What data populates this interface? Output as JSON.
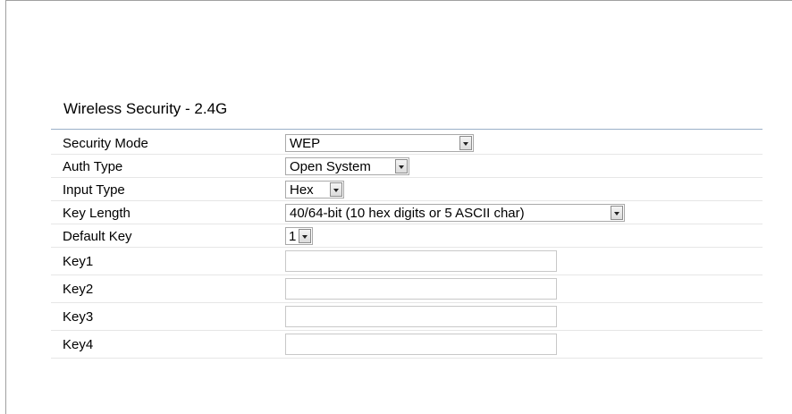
{
  "section": {
    "title": "Wireless Security - 2.4G"
  },
  "fields": {
    "security_mode": {
      "label": "Security Mode",
      "value": "WEP"
    },
    "auth_type": {
      "label": "Auth Type",
      "value": "Open System"
    },
    "input_type": {
      "label": "Input Type",
      "value": "Hex"
    },
    "key_length": {
      "label": "Key Length",
      "value": "40/64-bit (10 hex digits or 5 ASCII char)"
    },
    "default_key": {
      "label": "Default Key",
      "value": "1"
    },
    "key1": {
      "label": "Key1",
      "value": ""
    },
    "key2": {
      "label": "Key2",
      "value": ""
    },
    "key3": {
      "label": "Key3",
      "value": ""
    },
    "key4": {
      "label": "Key4",
      "value": ""
    }
  },
  "icons": {
    "dropdown": "chevron-down-icon"
  },
  "colors": {
    "title_rule": "#9ab0c8",
    "row_divider": "#e6e6e6",
    "input_border": "#a9a9a9"
  }
}
